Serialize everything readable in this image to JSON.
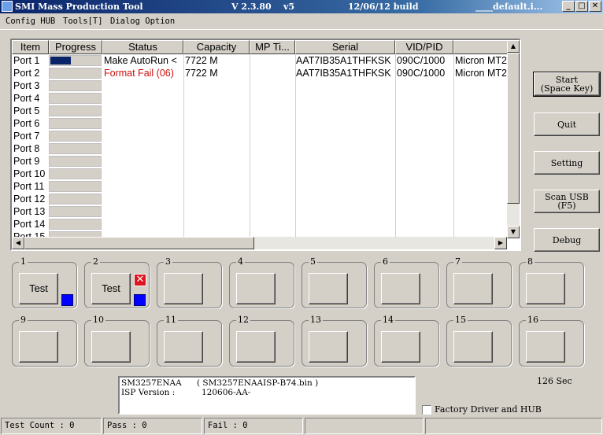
{
  "titlebar": {
    "title": "SMI Mass Production Tool",
    "version": "V 2.3.80    v5",
    "build": "12/06/12 build",
    "profile": "____default.i...",
    "minimize": "_",
    "maximize": "□",
    "close": "✕"
  },
  "menu": [
    "Config HUB",
    "Tools[T]",
    "Dialog Option"
  ],
  "table": {
    "columns": [
      "Item",
      "Progress",
      "Status",
      "Capacity",
      "MP Ti...",
      "Serial",
      "VID/PID",
      ""
    ],
    "rows": [
      {
        "item": "Port 1",
        "progress": 0.4,
        "status": "Make AutoRun <",
        "status_color": "#000000",
        "capacity": "7722 M",
        "mp": "",
        "serial": "AAT7IB35A1THFKSK",
        "vidpid": "090C/1000",
        "desc": "Micron MT2"
      },
      {
        "item": "Port 2",
        "progress": 0,
        "status": "Format Fail (06)",
        "status_color": "#cc1010",
        "capacity": "7722 M",
        "mp": "",
        "serial": "AAT7IB35A1THFKSK",
        "vidpid": "090C/1000",
        "desc": "Micron MT2"
      },
      {
        "item": "Port 3",
        "progress": 0,
        "status": "",
        "capacity": "",
        "mp": "",
        "serial": "",
        "vidpid": "",
        "desc": ""
      },
      {
        "item": "Port 4",
        "progress": 0,
        "status": "",
        "capacity": "",
        "mp": "",
        "serial": "",
        "vidpid": "",
        "desc": ""
      },
      {
        "item": "Port 5",
        "progress": 0,
        "status": "",
        "capacity": "",
        "mp": "",
        "serial": "",
        "vidpid": "",
        "desc": ""
      },
      {
        "item": "Port 6",
        "progress": 0,
        "status": "",
        "capacity": "",
        "mp": "",
        "serial": "",
        "vidpid": "",
        "desc": ""
      },
      {
        "item": "Port 7",
        "progress": 0,
        "status": "",
        "capacity": "",
        "mp": "",
        "serial": "",
        "vidpid": "",
        "desc": ""
      },
      {
        "item": "Port 8",
        "progress": 0,
        "status": "",
        "capacity": "",
        "mp": "",
        "serial": "",
        "vidpid": "",
        "desc": ""
      },
      {
        "item": "Port 9",
        "progress": 0,
        "status": "",
        "capacity": "",
        "mp": "",
        "serial": "",
        "vidpid": "",
        "desc": ""
      },
      {
        "item": "Port 10",
        "progress": 0,
        "status": "",
        "capacity": "",
        "mp": "",
        "serial": "",
        "vidpid": "",
        "desc": ""
      },
      {
        "item": "Port 11",
        "progress": 0,
        "status": "",
        "capacity": "",
        "mp": "",
        "serial": "",
        "vidpid": "",
        "desc": ""
      },
      {
        "item": "Port 12",
        "progress": 0,
        "status": "",
        "capacity": "",
        "mp": "",
        "serial": "",
        "vidpid": "",
        "desc": ""
      },
      {
        "item": "Port 13",
        "progress": 0,
        "status": "",
        "capacity": "",
        "mp": "",
        "serial": "",
        "vidpid": "",
        "desc": ""
      },
      {
        "item": "Port 14",
        "progress": 0,
        "status": "",
        "capacity": "",
        "mp": "",
        "serial": "",
        "vidpid": "",
        "desc": ""
      },
      {
        "item": "Port 15",
        "progress": 0,
        "status": "",
        "capacity": "",
        "mp": "",
        "serial": "",
        "vidpid": "",
        "desc": ""
      }
    ]
  },
  "buttons": {
    "start": [
      "Start",
      "(Space Key)"
    ],
    "quit": [
      "Quit"
    ],
    "setting": [
      "Setting"
    ],
    "scan": [
      "Scan USB",
      "(F5)"
    ],
    "debug": [
      "Debug"
    ]
  },
  "ports": [
    {
      "num": "1",
      "label": "Test",
      "indicator": "blue",
      "fail": false
    },
    {
      "num": "2",
      "label": "Test",
      "indicator": "blue",
      "fail": true
    },
    {
      "num": "3",
      "label": "",
      "indicator": "",
      "fail": false
    },
    {
      "num": "4",
      "label": "",
      "indicator": "",
      "fail": false
    },
    {
      "num": "5",
      "label": "",
      "indicator": "",
      "fail": false
    },
    {
      "num": "6",
      "label": "",
      "indicator": "",
      "fail": false
    },
    {
      "num": "7",
      "label": "",
      "indicator": "",
      "fail": false
    },
    {
      "num": "8",
      "label": "",
      "indicator": "",
      "fail": false
    },
    {
      "num": "9",
      "label": "",
      "indicator": "",
      "fail": false
    },
    {
      "num": "10",
      "label": "",
      "indicator": "",
      "fail": false
    },
    {
      "num": "11",
      "label": "",
      "indicator": "",
      "fail": false
    },
    {
      "num": "12",
      "label": "",
      "indicator": "",
      "fail": false
    },
    {
      "num": "13",
      "label": "",
      "indicator": "",
      "fail": false
    },
    {
      "num": "14",
      "label": "",
      "indicator": "",
      "fail": false
    },
    {
      "num": "15",
      "label": "",
      "indicator": "",
      "fail": false
    },
    {
      "num": "16",
      "label": "",
      "indicator": "",
      "fail": false
    }
  ],
  "info": {
    "controller": "SM3257ENAA",
    "isp_file": "( SM3257ENAAISP-B74.bin )",
    "isp_label": "ISP Version :",
    "isp_version": "120606-AA-"
  },
  "elapsed": "126 Sec",
  "factory_checkbox": {
    "label": "Factory Driver and HUB",
    "checked": false
  },
  "status": {
    "test_count": "Test Count : 0",
    "pass": "Pass : 0",
    "fail": "Fail : 0"
  },
  "colors": {
    "accent": "#0a246a",
    "fail": "#cc1010",
    "indicator": "#0000ff"
  }
}
